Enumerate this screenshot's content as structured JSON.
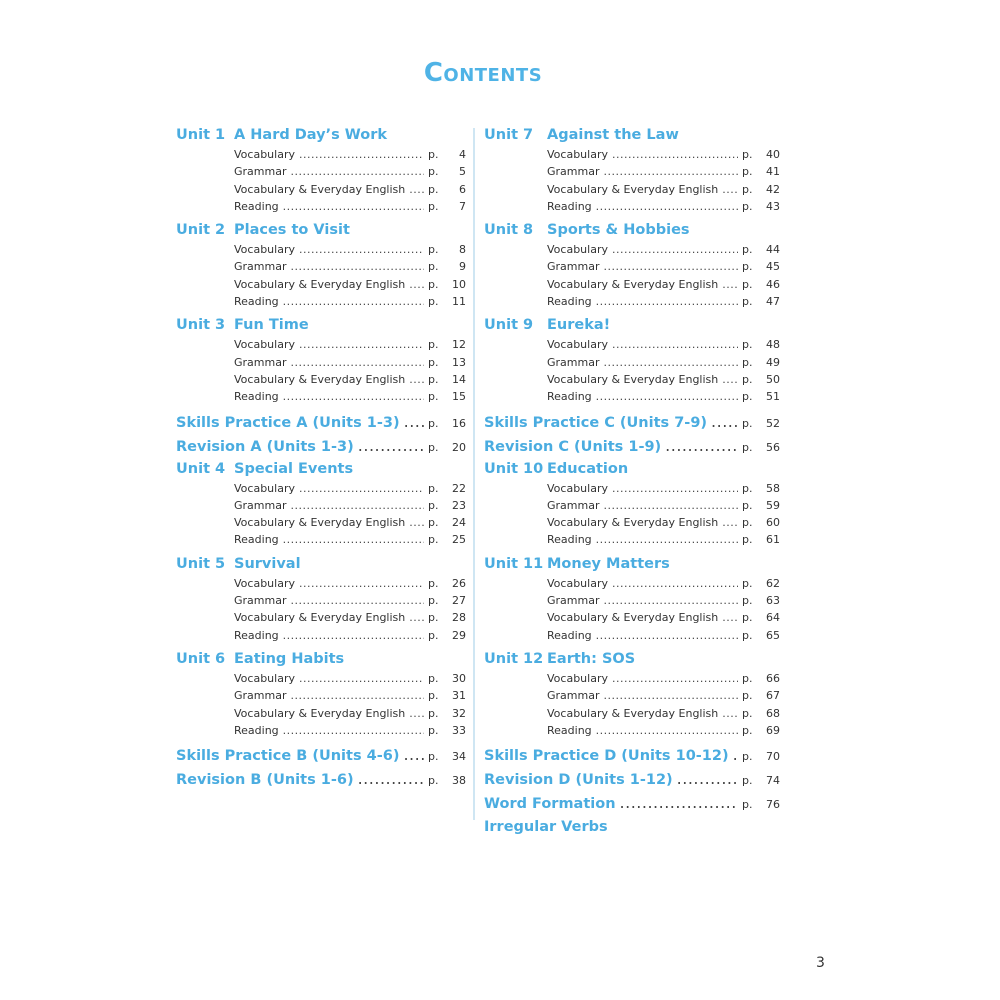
{
  "title": "Contents",
  "page_number": "3",
  "left": [
    {
      "type": "unit",
      "num": "Unit 1",
      "name": "A Hard Day’s Work",
      "items": [
        {
          "label": "Vocabulary",
          "p": "p.",
          "page": "4"
        },
        {
          "label": "Grammar",
          "p": "p.",
          "page": "5"
        },
        {
          "label": "Vocabulary & Everyday English",
          "p": "p.",
          "page": "6"
        },
        {
          "label": "Reading",
          "p": "p.",
          "page": "7"
        }
      ]
    },
    {
      "type": "unit",
      "num": "Unit 2",
      "name": "Places to Visit",
      "items": [
        {
          "label": "Vocabulary",
          "p": "p.",
          "page": "8"
        },
        {
          "label": "Grammar",
          "p": "p.",
          "page": "9"
        },
        {
          "label": "Vocabulary & Everyday English",
          "p": "p.",
          "page": "10"
        },
        {
          "label": "Reading",
          "p": "p.",
          "page": "11"
        }
      ]
    },
    {
      "type": "unit",
      "num": "Unit 3",
      "name": "Fun Time",
      "items": [
        {
          "label": "Vocabulary",
          "p": "p.",
          "page": "12"
        },
        {
          "label": "Grammar",
          "p": "p.",
          "page": "13"
        },
        {
          "label": "Vocabulary & Everyday English",
          "p": "p.",
          "page": "14"
        },
        {
          "label": "Reading",
          "p": "p.",
          "page": "15"
        }
      ]
    },
    {
      "type": "big",
      "label": "Skills Practice A (Units 1-3)",
      "p": "p.",
      "page": "16"
    },
    {
      "type": "big",
      "label": "Revision A (Units 1-3)",
      "p": "p.",
      "page": "20"
    },
    {
      "type": "unit",
      "num": "Unit 4",
      "name": "Special Events",
      "items": [
        {
          "label": "Vocabulary",
          "p": "p.",
          "page": "22"
        },
        {
          "label": "Grammar",
          "p": "p.",
          "page": "23"
        },
        {
          "label": "Vocabulary & Everyday English",
          "p": "p.",
          "page": "24"
        },
        {
          "label": "Reading",
          "p": "p.",
          "page": "25"
        }
      ]
    },
    {
      "type": "unit",
      "num": "Unit 5",
      "name": "Survival",
      "items": [
        {
          "label": "Vocabulary",
          "p": "p.",
          "page": "26"
        },
        {
          "label": "Grammar",
          "p": "p.",
          "page": "27"
        },
        {
          "label": "Vocabulary & Everyday English",
          "p": "p.",
          "page": "28"
        },
        {
          "label": "Reading",
          "p": "p.",
          "page": "29"
        }
      ]
    },
    {
      "type": "unit",
      "num": "Unit 6",
      "name": "Eating Habits",
      "items": [
        {
          "label": "Vocabulary",
          "p": "p.",
          "page": "30"
        },
        {
          "label": "Grammar",
          "p": "p.",
          "page": "31"
        },
        {
          "label": "Vocabulary & Everyday English",
          "p": "p.",
          "page": "32"
        },
        {
          "label": "Reading",
          "p": "p.",
          "page": "33"
        }
      ]
    },
    {
      "type": "big",
      "label": "Skills Practice B (Units 4-6)",
      "p": "p.",
      "page": "34"
    },
    {
      "type": "big",
      "label": "Revision B (Units 1-6)",
      "p": "p.",
      "page": "38"
    }
  ],
  "right": [
    {
      "type": "unit",
      "num": "Unit 7",
      "name": "Against the Law",
      "items": [
        {
          "label": "Vocabulary",
          "p": "p.",
          "page": "40"
        },
        {
          "label": "Grammar",
          "p": "p.",
          "page": "41"
        },
        {
          "label": "Vocabulary & Everyday English",
          "p": "p.",
          "page": "42"
        },
        {
          "label": "Reading",
          "p": "p.",
          "page": "43"
        }
      ]
    },
    {
      "type": "unit",
      "num": "Unit 8",
      "name": "Sports & Hobbies",
      "items": [
        {
          "label": "Vocabulary",
          "p": "p.",
          "page": "44"
        },
        {
          "label": "Grammar",
          "p": "p.",
          "page": "45"
        },
        {
          "label": "Vocabulary & Everyday English",
          "p": "p.",
          "page": "46"
        },
        {
          "label": "Reading",
          "p": "p.",
          "page": "47"
        }
      ]
    },
    {
      "type": "unit",
      "num": "Unit 9",
      "name": "Eureka!",
      "items": [
        {
          "label": "Vocabulary",
          "p": "p.",
          "page": "48"
        },
        {
          "label": "Grammar",
          "p": "p.",
          "page": "49"
        },
        {
          "label": "Vocabulary & Everyday English",
          "p": "p.",
          "page": "50"
        },
        {
          "label": "Reading",
          "p": "p.",
          "page": "51"
        }
      ]
    },
    {
      "type": "big",
      "label": "Skills Practice C (Units 7-9)",
      "p": "p.",
      "page": "52"
    },
    {
      "type": "big",
      "label": "Revision C (Units 1-9)",
      "p": "p.",
      "page": "56"
    },
    {
      "type": "unit",
      "num": "Unit 10",
      "name": "Education",
      "items": [
        {
          "label": "Vocabulary",
          "p": "p.",
          "page": "58"
        },
        {
          "label": "Grammar",
          "p": "p.",
          "page": "59"
        },
        {
          "label": "Vocabulary & Everyday English",
          "p": "p.",
          "page": "60"
        },
        {
          "label": "Reading",
          "p": "p.",
          "page": "61"
        }
      ]
    },
    {
      "type": "unit",
      "num": "Unit 11",
      "name": "Money Matters",
      "items": [
        {
          "label": "Vocabulary",
          "p": "p.",
          "page": "62"
        },
        {
          "label": "Grammar",
          "p": "p.",
          "page": "63"
        },
        {
          "label": "Vocabulary & Everyday English",
          "p": "p.",
          "page": "64"
        },
        {
          "label": "Reading",
          "p": "p.",
          "page": "65"
        }
      ]
    },
    {
      "type": "unit",
      "num": "Unit 12",
      "name": "Earth: SOS",
      "items": [
        {
          "label": "Vocabulary",
          "p": "p.",
          "page": "66"
        },
        {
          "label": "Grammar",
          "p": "p.",
          "page": "67"
        },
        {
          "label": "Vocabulary & Everyday English",
          "p": "p.",
          "page": "68"
        },
        {
          "label": "Reading",
          "p": "p.",
          "page": "69"
        }
      ]
    },
    {
      "type": "big",
      "label": "Skills Practice D (Units 10-12)",
      "p": "p.",
      "page": "70"
    },
    {
      "type": "big",
      "label": "Revision D (Units 1-12)",
      "p": "p.",
      "page": "74"
    },
    {
      "type": "big",
      "label": "Word Formation",
      "p": "p.",
      "page": "76"
    },
    {
      "type": "big",
      "label": "Irregular Verbs",
      "p": "",
      "page": ""
    }
  ]
}
